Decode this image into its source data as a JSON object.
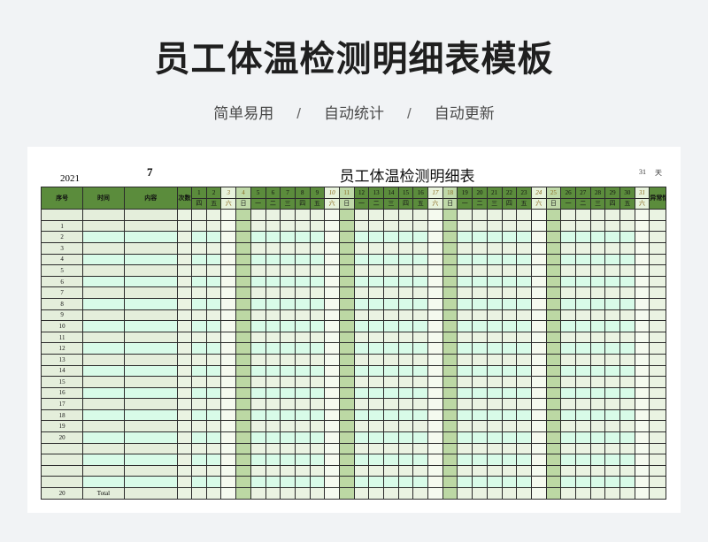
{
  "page": {
    "title": "员工体温检测明细表模板",
    "tags": [
      "简单易用",
      "自动统计",
      "自动更新"
    ],
    "separator": "/"
  },
  "sheet": {
    "year": "2021",
    "month": "7",
    "title": "员工体温检测明细表",
    "days_count": "31",
    "days_unit": "天"
  },
  "columns": {
    "index": "序号",
    "time": "时间",
    "content": "内容",
    "count": "次数",
    "abnormal": "异常情况"
  },
  "days": [
    "1",
    "2",
    "3",
    "4",
    "5",
    "6",
    "7",
    "8",
    "9",
    "10",
    "11",
    "12",
    "13",
    "14",
    "15",
    "16",
    "17",
    "18",
    "19",
    "20",
    "21",
    "22",
    "23",
    "24",
    "25",
    "26",
    "27",
    "28",
    "29",
    "30",
    "31"
  ],
  "weekdays": [
    "四",
    "五",
    "六",
    "日",
    "一",
    "二",
    "三",
    "四",
    "五",
    "六",
    "日",
    "一",
    "二",
    "三",
    "四",
    "五",
    "六",
    "日",
    "一",
    "二",
    "三",
    "四",
    "五",
    "六",
    "日",
    "一",
    "二",
    "三",
    "四",
    "五",
    "六"
  ],
  "weekend_sat": [
    3,
    10,
    17,
    24,
    31
  ],
  "weekend_sun": [
    4,
    11,
    18,
    25
  ],
  "rows": [
    "1",
    "2",
    "3",
    "4",
    "5",
    "6",
    "7",
    "8",
    "9",
    "10",
    "11",
    "12",
    "13",
    "14",
    "15",
    "16",
    "17",
    "18",
    "19",
    "20",
    "",
    "",
    "",
    ""
  ],
  "footer": {
    "count": "20",
    "label": "Total"
  },
  "colors": {
    "header_green": "#5b8c3c",
    "sunday_green": "#bcd8a4",
    "mint": "#d8fbe8",
    "light": "#e4eedb"
  }
}
